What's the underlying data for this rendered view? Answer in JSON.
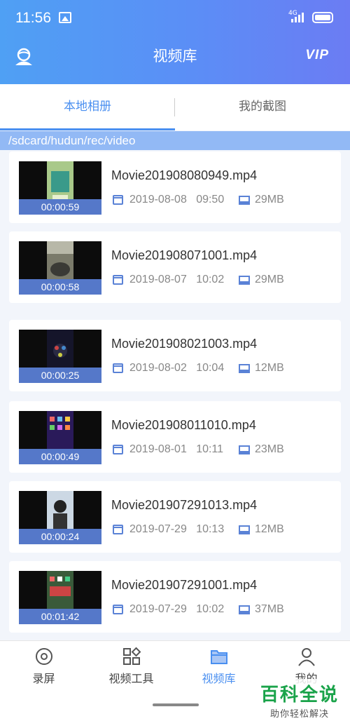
{
  "status_bar": {
    "time": "11:56",
    "network": "4G"
  },
  "header": {
    "title": "视频库",
    "vip_label": "VIP"
  },
  "tabs": [
    {
      "label": "本地相册",
      "active": true
    },
    {
      "label": "我的截图",
      "active": false
    }
  ],
  "path": "/sdcard/hudun/rec/video",
  "videos": [
    {
      "name": "Movie201908080949.mp4",
      "duration": "00:00:59",
      "date": "2019-08-08",
      "time": "09:50",
      "size": "29MB"
    },
    {
      "name": "Movie201908071001.mp4",
      "duration": "00:00:58",
      "date": "2019-08-07",
      "time": "10:02",
      "size": "29MB"
    },
    {
      "name": "Movie201908021003.mp4",
      "duration": "00:00:25",
      "date": "2019-08-02",
      "time": "10:04",
      "size": "12MB"
    },
    {
      "name": "Movie201908011010.mp4",
      "duration": "00:00:49",
      "date": "2019-08-01",
      "time": "10:11",
      "size": "23MB"
    },
    {
      "name": "Movie201907291013.mp4",
      "duration": "00:00:24",
      "date": "2019-07-29",
      "time": "10:13",
      "size": "12MB"
    },
    {
      "name": "Movie201907291001.mp4",
      "duration": "00:01:42",
      "date": "2019-07-29",
      "time": "10:02",
      "size": "37MB"
    }
  ],
  "bottom_nav": [
    {
      "label": "录屏",
      "icon": "record-icon",
      "active": false
    },
    {
      "label": "视频工具",
      "icon": "tools-icon",
      "active": false
    },
    {
      "label": "视频库",
      "icon": "folder-icon",
      "active": true
    },
    {
      "label": "我的",
      "icon": "profile-icon",
      "active": false
    }
  ],
  "watermark": {
    "title": "百科全说",
    "subtitle": "助你轻松解决"
  },
  "colors": {
    "accent": "#4a8ff0",
    "header_start": "#4fa0f4",
    "header_end": "#6b7cf3",
    "duration_bg": "#5578c9"
  }
}
